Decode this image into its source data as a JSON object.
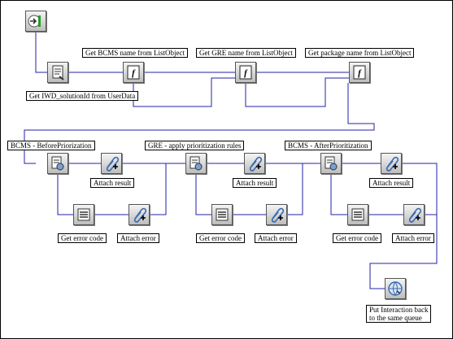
{
  "labels": {
    "get_bcms_name": "Get BCMS name from ListObject",
    "get_gre_name": "Get GRE name from ListObject",
    "get_package_name": "Get package name from ListObject",
    "get_iwd_solution": "Get IWD_solutionId from UserData",
    "bcms_before": "BCMS - BeforePriorization",
    "gre_apply": "GRE - apply prioritization rules",
    "bcms_after": "BCMS - AfterPrioritization",
    "attach_result_1": "Attach result",
    "attach_result_2": "Attach result",
    "attach_result_3": "Attach result",
    "get_error_code_1": "Get error code",
    "get_error_code_2": "Get error code",
    "get_error_code_3": "Get error code",
    "attach_error_1": "Attach error",
    "attach_error_2": "Attach error",
    "attach_error_3": "Attach error",
    "put_back_line1": "Put Interaction back",
    "put_back_line2": "to the same queue"
  },
  "colors": {
    "wire": "#2222aa",
    "border": "#000000"
  },
  "icons": {
    "entry": "entry-arrow-icon",
    "form": "form-icon",
    "function": "function-f-icon",
    "service": "service-icon",
    "attach": "attach-paperclip-icon",
    "list": "list-icon",
    "queue": "queue-globe-icon"
  }
}
